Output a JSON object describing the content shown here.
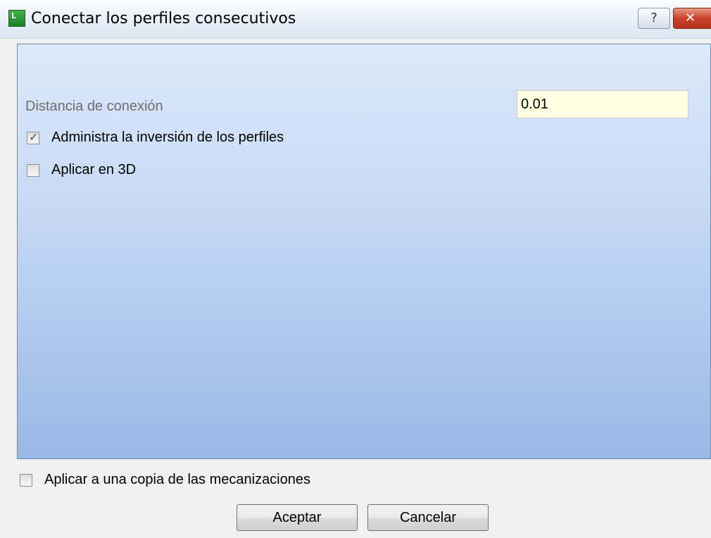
{
  "window": {
    "title": "Conectar los perfiles consecutivos",
    "help_label": "?",
    "close_label": "✕",
    "app_icon_text": "L"
  },
  "form": {
    "distance_label": "Distancia de conexión",
    "distance_value": "0.01",
    "invert_profiles": {
      "label": "Administra la inversión de los perfiles",
      "checked": true
    },
    "apply_3d": {
      "label": "Aplicar en 3D",
      "checked": false
    }
  },
  "footer": {
    "apply_copy": {
      "label": "Aplicar a una copia de las mecanizaciones",
      "checked": false
    },
    "accept_label": "Aceptar",
    "cancel_label": "Cancelar"
  }
}
